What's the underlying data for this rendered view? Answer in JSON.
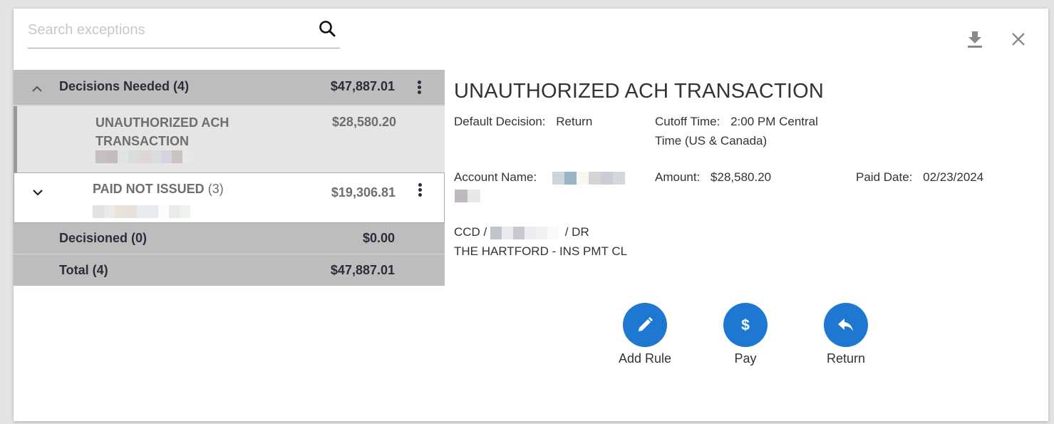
{
  "search": {
    "placeholder": "Search exceptions",
    "value": ""
  },
  "toolbar": {
    "download_icon": "download-icon",
    "close_icon": "close-icon"
  },
  "list": {
    "group": {
      "label": "Decisions Needed (4)",
      "amount": "$47,887.01",
      "expanded": true
    },
    "items": [
      {
        "title": "UNAUTHORIZED ACH TRANSACTION",
        "amount": "$28,580.20",
        "selected": true,
        "subtitle_redacted": true
      },
      {
        "title": "PAID NOT ISSUED",
        "count": "(3)",
        "amount": "$19,306.81",
        "selected": false,
        "expanded": false,
        "subtitle_redacted": true
      }
    ],
    "decisioned": {
      "label": "Decisioned (0)",
      "amount": "$0.00"
    },
    "total": {
      "label": "Total (4)",
      "amount": "$47,887.01"
    }
  },
  "detail": {
    "title": "UNAUTHORIZED ACH TRANSACTION",
    "default_decision_label": "Default Decision:",
    "default_decision_value": "Return",
    "cutoff_label": "Cutoff Time:",
    "cutoff_value_line1": "2:00 PM Central",
    "cutoff_value_line2": "Time (US & Canada)",
    "account_name_label": "Account Name:",
    "amount_label": "Amount:",
    "amount_value": "$28,580.20",
    "paid_date_label": "Paid Date:",
    "paid_date_value": "02/23/2024",
    "entry_prefix": "CCD / ",
    "entry_suffix": " / DR",
    "description": "THE HARTFORD - INS PMT CL"
  },
  "actions": [
    {
      "label": "Add Rule",
      "icon": "pencil-icon"
    },
    {
      "label": "Pay",
      "icon": "dollar-icon"
    },
    {
      "label": "Return",
      "icon": "reply-icon"
    }
  ],
  "colors": {
    "accent": "#1e78d2",
    "group_bg": "#bdbdbd",
    "selected_bg": "#e5e5e5"
  }
}
